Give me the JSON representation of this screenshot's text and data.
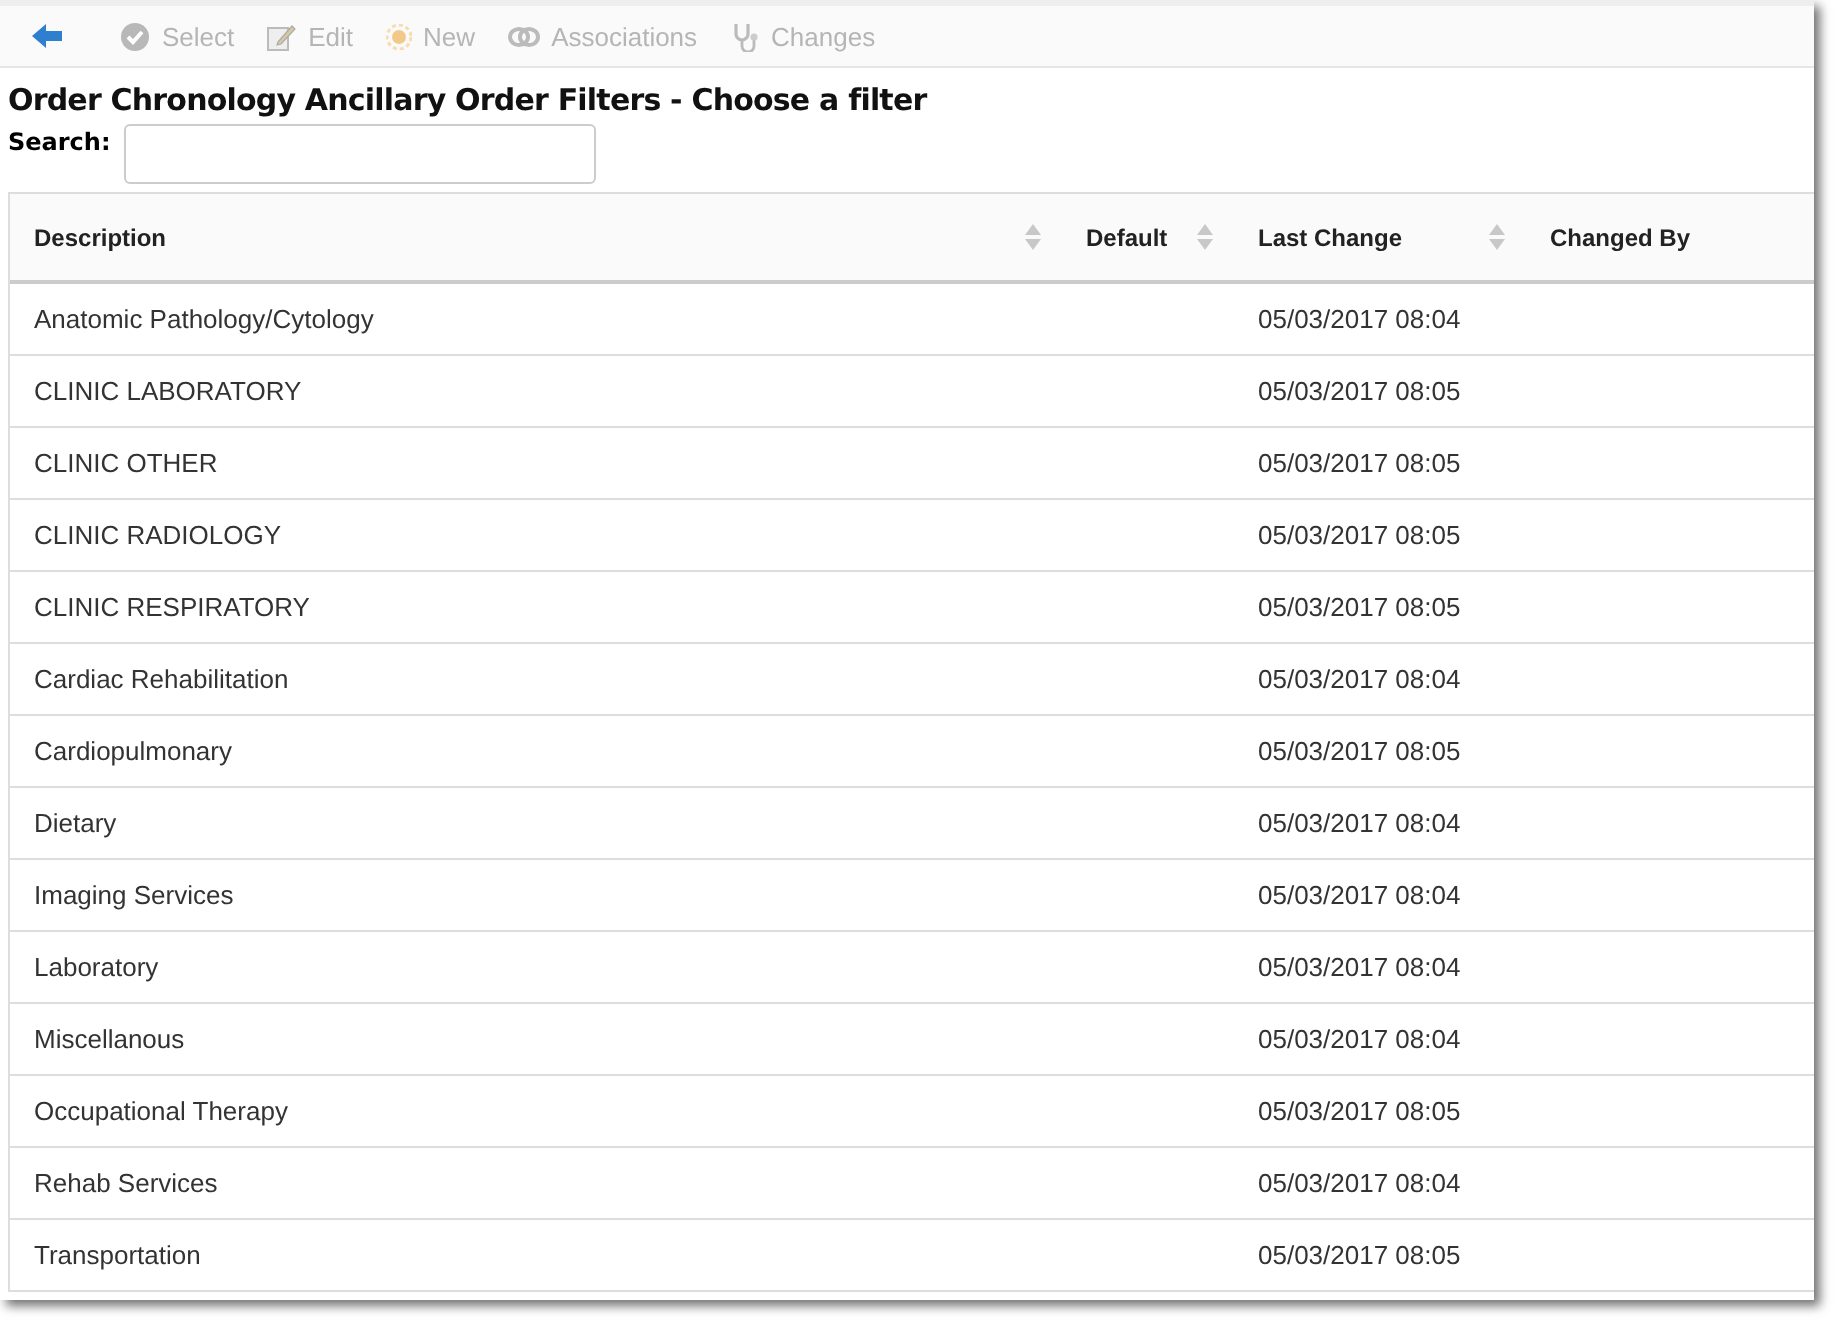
{
  "toolbar": [
    {
      "kind": "select",
      "label": "Select",
      "disabled": true
    },
    {
      "kind": "edit",
      "label": "Edit",
      "disabled": true
    },
    {
      "kind": "new",
      "label": "New",
      "disabled": true
    },
    {
      "kind": "associations",
      "label": "Associations",
      "disabled": true
    },
    {
      "kind": "changes",
      "label": "Changes",
      "disabled": true
    }
  ],
  "title": "Order Chronology Ancillary Order Filters - Choose a filter",
  "search": {
    "label": "Search:"
  },
  "table": {
    "columns": [
      {
        "label": "Description",
        "sortable": true
      },
      {
        "label": "Default",
        "sortable": true
      },
      {
        "label": "Last Change",
        "sortable": true
      },
      {
        "label": "Changed By",
        "sortable": false
      }
    ],
    "rows": [
      [
        "Anatomic Pathology/Cytology",
        "05/03/2017 08:04"
      ],
      [
        "CLINIC LABORATORY",
        "05/03/2017 08:05"
      ],
      [
        "CLINIC OTHER",
        "05/03/2017 08:05"
      ],
      [
        "CLINIC RADIOLOGY",
        "05/03/2017 08:05"
      ],
      [
        "CLINIC RESPIRATORY",
        "05/03/2017 08:05"
      ],
      [
        "Cardiac Rehabilitation",
        "05/03/2017 08:04"
      ],
      [
        "Cardiopulmonary",
        "05/03/2017 08:05"
      ],
      [
        "Dietary",
        "05/03/2017 08:04"
      ],
      [
        "Imaging Services",
        "05/03/2017 08:04"
      ],
      [
        "Laboratory",
        "05/03/2017 08:04"
      ],
      [
        "Miscellanous",
        "05/03/2017 08:04"
      ],
      [
        "Occupational Therapy",
        "05/03/2017 08:05"
      ],
      [
        "Rehab Services",
        "05/03/2017 08:04"
      ],
      [
        "Transportation",
        "05/03/2017 08:05"
      ]
    ]
  }
}
